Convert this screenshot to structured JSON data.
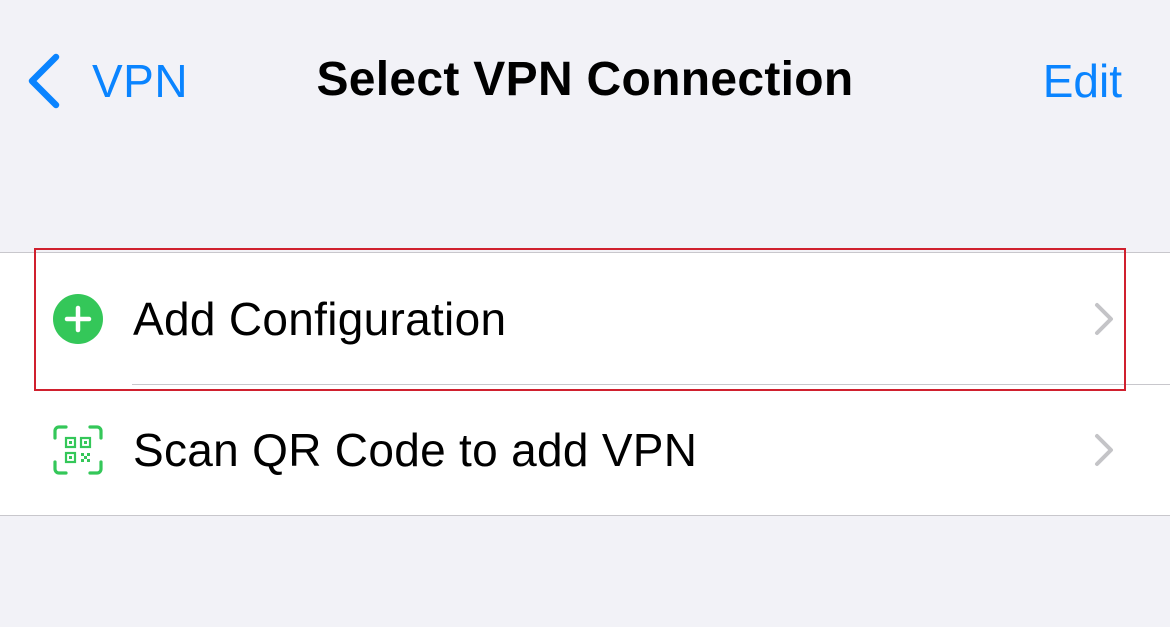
{
  "nav": {
    "back_label": "VPN",
    "title": "Select VPN Connection",
    "edit_label": "Edit"
  },
  "list": {
    "items": [
      {
        "label": "Add Configuration",
        "icon": "plus-circle-icon",
        "icon_color": "#34c759"
      },
      {
        "label": "Scan QR Code to add VPN",
        "icon": "qr-code-scan-icon",
        "icon_color": "#34c759"
      }
    ]
  },
  "colors": {
    "accent": "#0a84ff",
    "background": "#f2f2f7",
    "highlight": "#d0202e",
    "chevron": "#c4c4c7"
  }
}
